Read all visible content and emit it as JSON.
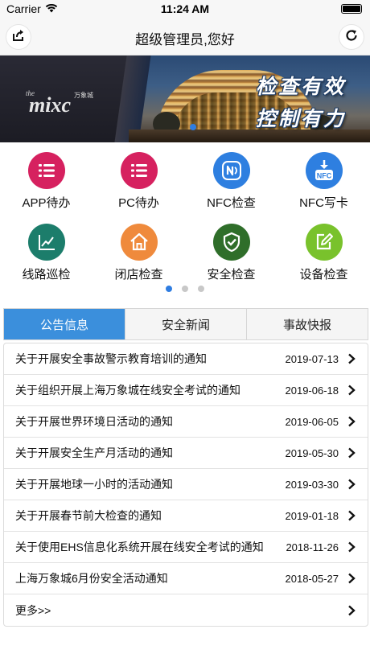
{
  "status_bar": {
    "carrier": "Carrier",
    "time": "11:24 AM"
  },
  "nav": {
    "title": "超级管理员,您好",
    "left_icon": "share-icon",
    "right_icon": "refresh-icon"
  },
  "banner": {
    "logo_text": "the mixc",
    "logo_sub": "万象城",
    "slogan_line1": "检查有效",
    "slogan_line2": "控制有力"
  },
  "grid": [
    {
      "label": "APP待办",
      "icon": "list-icon",
      "color": "#d6215f"
    },
    {
      "label": "PC待办",
      "icon": "list-icon",
      "color": "#d6215f"
    },
    {
      "label": "NFC检查",
      "icon": "nfc-icon",
      "color": "#2e7fe0"
    },
    {
      "label": "NFC写卡",
      "icon": "nfc-download-icon",
      "color": "#2e7fe0"
    },
    {
      "label": "线路巡检",
      "icon": "line-chart-icon",
      "color": "#1c7d6b"
    },
    {
      "label": "闭店检查",
      "icon": "house-icon",
      "color": "#ef8a3c"
    },
    {
      "label": "安全检查",
      "icon": "shield-check-icon",
      "color": "#2f6e2a"
    },
    {
      "label": "设备检查",
      "icon": "edit-icon",
      "color": "#79c22c"
    }
  ],
  "pager": {
    "pages": 3,
    "active": 1
  },
  "tabs": [
    {
      "label": "公告信息",
      "active": true
    },
    {
      "label": "安全新闻",
      "active": false
    },
    {
      "label": "事故快报",
      "active": false
    }
  ],
  "notices": [
    {
      "title": "关于开展安全事故警示教育培训的通知",
      "date": "2019-07-13"
    },
    {
      "title": "关于组织开展上海万象城在线安全考试的通知",
      "date": "2019-06-18"
    },
    {
      "title": "关于开展世界环境日活动的通知",
      "date": "2019-06-05"
    },
    {
      "title": "关于开展安全生产月活动的通知",
      "date": "2019-05-30"
    },
    {
      "title": "关于开展地球一小时的活动通知",
      "date": "2019-03-30"
    },
    {
      "title": "关于开展春节前大检查的通知",
      "date": "2019-01-18"
    },
    {
      "title": "关于使用EHS信息化系统开展在线安全考试的通知",
      "date": "2018-11-26"
    },
    {
      "title": "上海万象城6月份安全活动通知",
      "date": "2018-05-27"
    }
  ],
  "more_label": "更多>>",
  "colors": {
    "accent": "#3b8fdc",
    "status_bg": "#f7f7f7"
  }
}
